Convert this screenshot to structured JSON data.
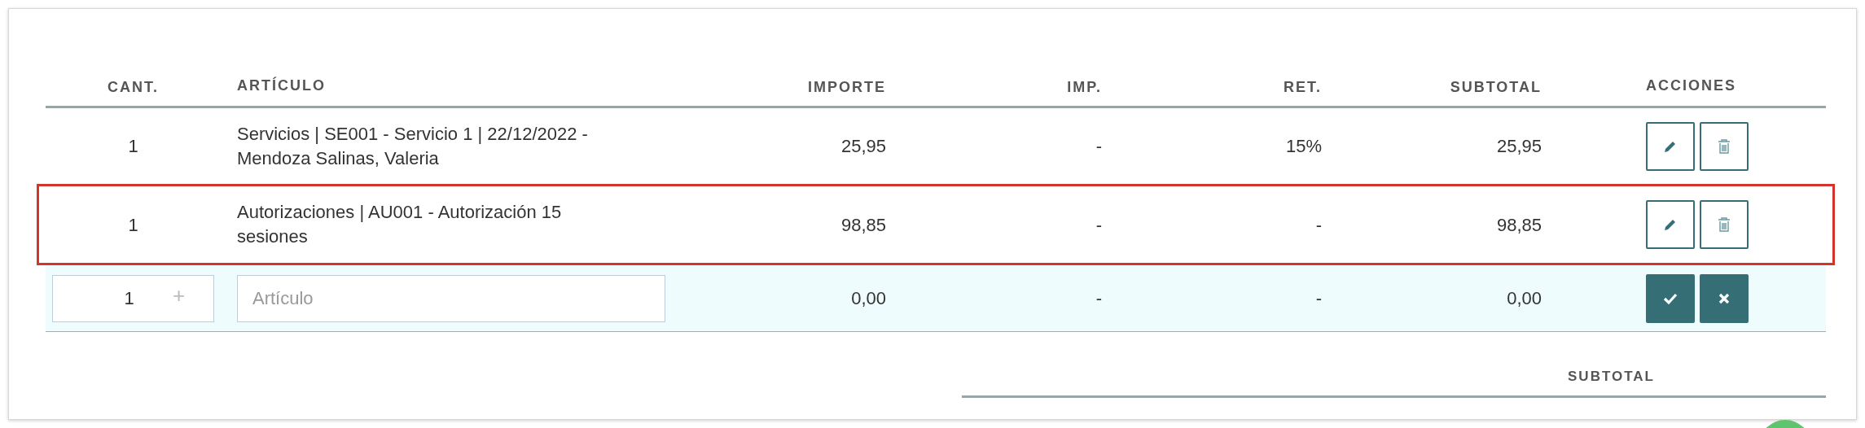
{
  "columns": [
    {
      "label": "CANT."
    },
    {
      "label": "ARTÍCULO"
    },
    {
      "label": "IMPORTE"
    },
    {
      "label": "IMP."
    },
    {
      "label": "RET."
    },
    {
      "label": "SUBTOTAL"
    },
    {
      "label": "ACCIONES"
    }
  ],
  "rows": [
    {
      "cantidad": "1",
      "articulo": "Servicios | SE001 - Servicio 1 | 22/12/2022 - Mendoza Salinas, Valeria",
      "importe": "25,95",
      "imp": "-",
      "ret": "15%",
      "subtotal": "25,95",
      "highlighted": false
    },
    {
      "cantidad": "1",
      "articulo": "Autorizaciones | AU001 - Autorización 15 sesiones",
      "importe": "98,85",
      "imp": "-",
      "ret": "-",
      "subtotal": "98,85",
      "highlighted": true
    }
  ],
  "new_row": {
    "cantidad": "1",
    "increment": "+",
    "articulo_placeholder": "Artículo",
    "importe": "0,00",
    "imp": "-",
    "ret": "-",
    "subtotal": "0,00"
  },
  "summary": {
    "label": "SUBTOTAL"
  }
}
